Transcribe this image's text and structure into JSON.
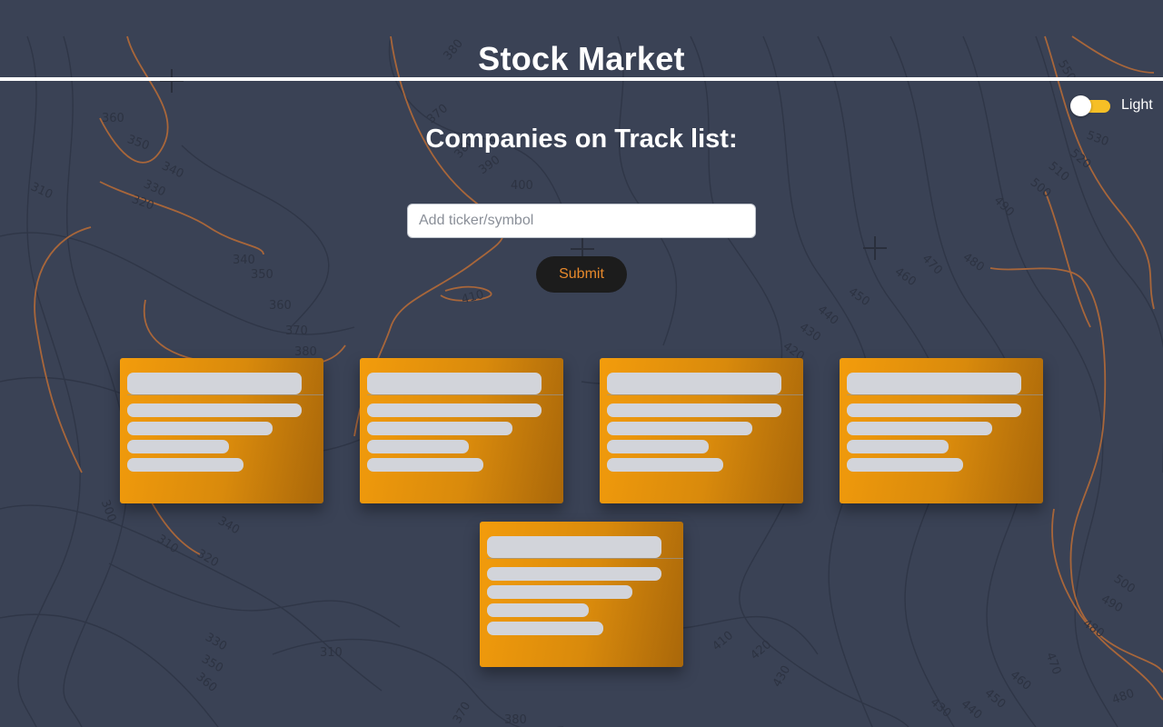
{
  "header": {
    "title": "Stock Market"
  },
  "theme_toggle": {
    "label": "Light",
    "checked": true,
    "accent": "#f6bf26"
  },
  "track_list": {
    "title": "Companies on Track list:",
    "input": {
      "value": "",
      "placeholder": "Add ticker/symbol"
    },
    "submit_label": "Submit"
  },
  "cards": [
    {
      "state": "loading"
    },
    {
      "state": "loading"
    },
    {
      "state": "loading"
    },
    {
      "state": "loading"
    },
    {
      "state": "loading"
    }
  ],
  "colors": {
    "background": "#3a4255",
    "card_start": "#f39c0c",
    "card_end": "#a9670a",
    "skeleton": "#d2d4da",
    "button_bg": "#1c1c1c",
    "button_text": "#e8892b",
    "contour_orange": "#a8663a",
    "contour_dark": "#2f3647"
  },
  "background_map": {
    "contour_labels": [
      "380",
      "370",
      "390",
      "400",
      "410",
      "360",
      "350",
      "340",
      "330",
      "320",
      "310",
      "340",
      "350",
      "360",
      "370",
      "380",
      "300",
      "340",
      "310",
      "320",
      "330",
      "350",
      "360",
      "310",
      "370",
      "380",
      "410",
      "420",
      "430",
      "440",
      "450",
      "460",
      "470",
      "480",
      "490",
      "500",
      "510",
      "520",
      "530",
      "550",
      "470",
      "480",
      "490",
      "500",
      "480",
      "470",
      "460",
      "450",
      "440",
      "430",
      "420",
      "390"
    ]
  }
}
